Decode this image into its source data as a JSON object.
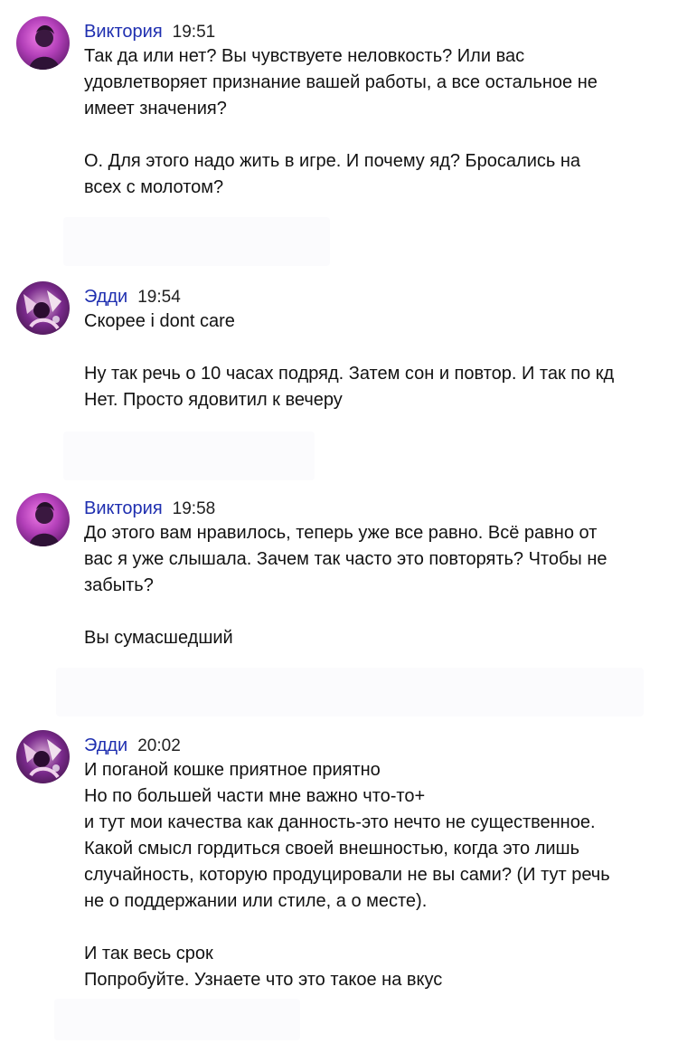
{
  "messages": [
    {
      "author": "Виктория",
      "time": "19:51",
      "lines": [
        "Так да или нет? Вы чувствуете неловкость? Или вас",
        "удовлетворяет признание вашей работы, а все остальное не",
        "имеет значения?",
        "",
        "О. Для этого надо жить в игре. И почему яд? Бросались на",
        "всех с молотом?"
      ]
    },
    {
      "author": "Эдди",
      "time": "19:54",
      "lines": [
        "Скорее i dont care",
        "",
        "Ну так речь о 10 часах подряд. Затем сон и повтор. И так по кд",
        "Нет. Просто ядовитил к вечеру"
      ]
    },
    {
      "author": "Виктория",
      "time": "19:58",
      "lines": [
        "До этого вам нравилось, теперь уже все равно. Всё равно от",
        "вас я уже слышала. Зачем так часто это повторять? Чтобы не",
        "забыть?",
        "",
        "Вы сумасшедший"
      ]
    },
    {
      "author": "Эдди",
      "time": "20:02",
      "lines": [
        "И поганой кошке приятное приятно",
        "Но по большей части мне важно что-то+",
        "и тут мои качества как данность-это нечто не существенное.",
        "Какой смысл гордиться своей внешностью, когда это лишь",
        "случайность, которую продуцировали не вы сами? (И тут речь",
        "не о поддержании или стиле, а о месте).",
        "",
        "И так весь срок",
        "Попробуйте. Узнаете что это такое на вкус"
      ]
    }
  ],
  "colors": {
    "author": "#1f2fb0",
    "text": "#121212",
    "avatar_viktoria": "#b23fb8",
    "avatar_eddie": "#7a2a8c"
  },
  "icons": {
    "viktoria_avatar": "profile-photo-purple-silhouette",
    "eddie_avatar": "profile-photo-purple-artwork"
  }
}
